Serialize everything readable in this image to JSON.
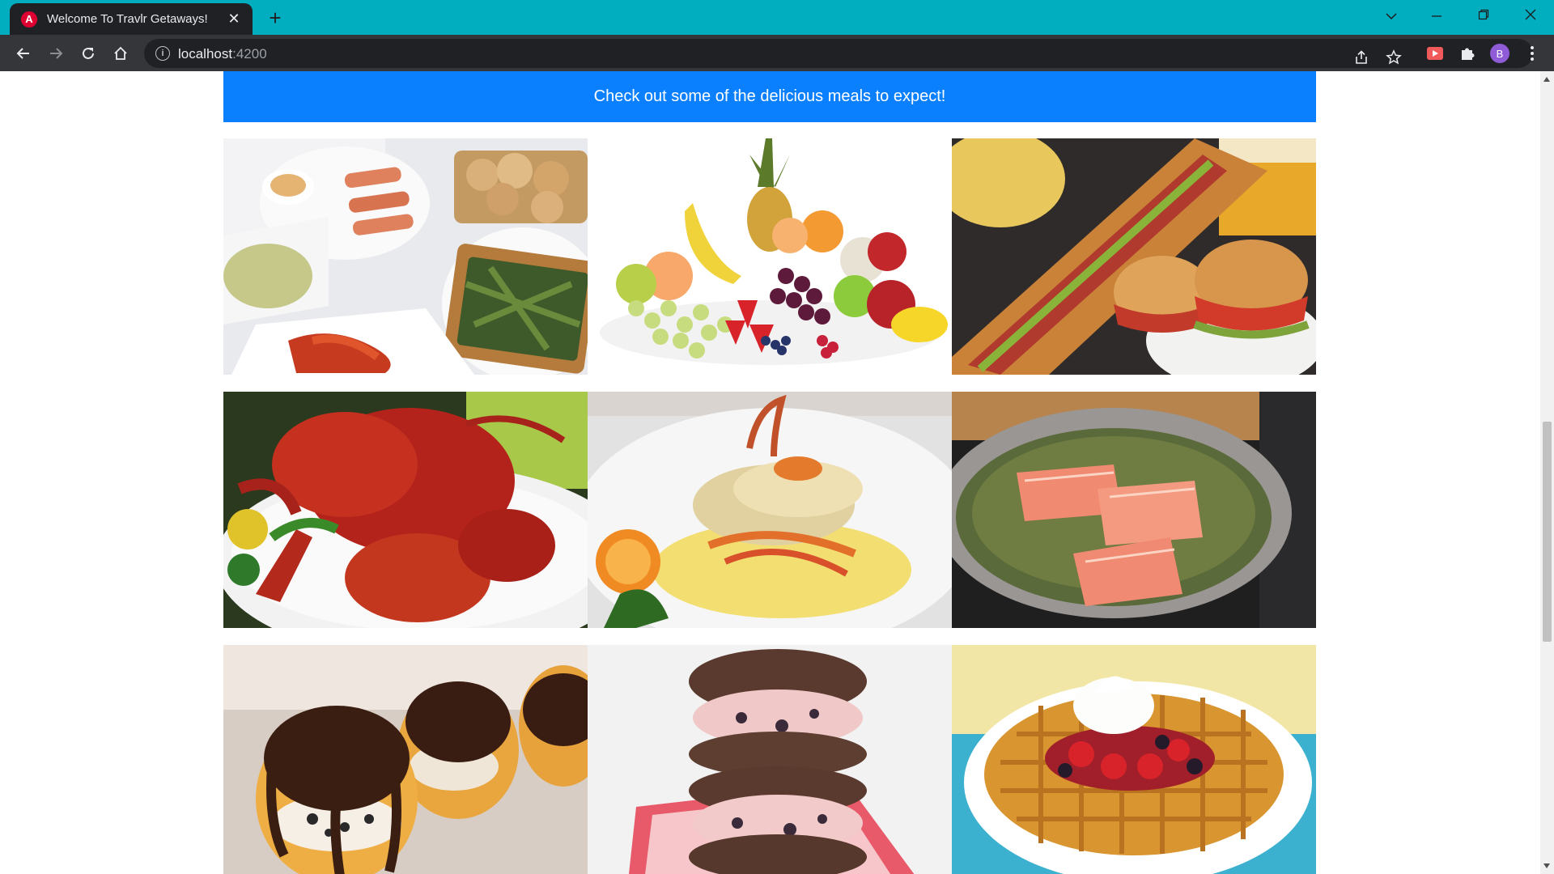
{
  "browser": {
    "tab_title": "Welcome To Travlr Getaways!",
    "favicon_letter": "A",
    "new_tab_symbol": "+",
    "close_symbol": "✕",
    "url_host": "localhost",
    "url_port": ":4200",
    "profile_initial": "B",
    "icons": [
      "back-arrow-icon",
      "forward-arrow-icon",
      "reload-icon",
      "home-icon",
      "site-info-icon",
      "share-icon",
      "bookmark-star-icon",
      "extension-icon",
      "puzzle-icon",
      "kebab-menu-icon"
    ]
  },
  "page": {
    "banner_text": "Check out some of the delicious meals to expect!",
    "banner_color": "#0a80ff",
    "meals": [
      "salmon-platter",
      "fruit-assortment",
      "submarine-sandwich",
      "lobster",
      "fish-entree",
      "salmon-in-pan",
      "cream-puffs",
      "ice-cream-sandwich",
      "berry-waffle"
    ]
  }
}
